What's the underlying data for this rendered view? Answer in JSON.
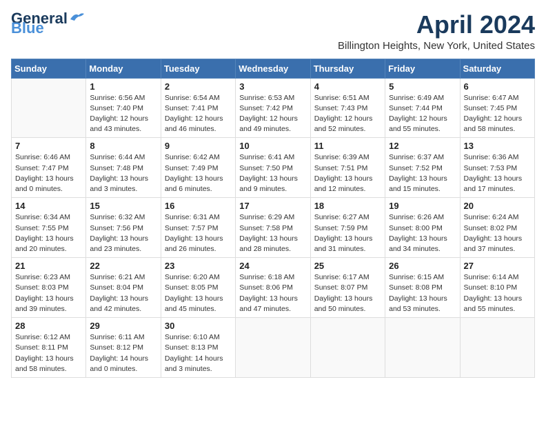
{
  "header": {
    "logo_general": "General",
    "logo_blue": "Blue",
    "month": "April 2024",
    "location": "Billington Heights, New York, United States"
  },
  "weekdays": [
    "Sunday",
    "Monday",
    "Tuesday",
    "Wednesday",
    "Thursday",
    "Friday",
    "Saturday"
  ],
  "weeks": [
    [
      {
        "day": "",
        "info": ""
      },
      {
        "day": "1",
        "info": "Sunrise: 6:56 AM\nSunset: 7:40 PM\nDaylight: 12 hours\nand 43 minutes."
      },
      {
        "day": "2",
        "info": "Sunrise: 6:54 AM\nSunset: 7:41 PM\nDaylight: 12 hours\nand 46 minutes."
      },
      {
        "day": "3",
        "info": "Sunrise: 6:53 AM\nSunset: 7:42 PM\nDaylight: 12 hours\nand 49 minutes."
      },
      {
        "day": "4",
        "info": "Sunrise: 6:51 AM\nSunset: 7:43 PM\nDaylight: 12 hours\nand 52 minutes."
      },
      {
        "day": "5",
        "info": "Sunrise: 6:49 AM\nSunset: 7:44 PM\nDaylight: 12 hours\nand 55 minutes."
      },
      {
        "day": "6",
        "info": "Sunrise: 6:47 AM\nSunset: 7:45 PM\nDaylight: 12 hours\nand 58 minutes."
      }
    ],
    [
      {
        "day": "7",
        "info": "Sunrise: 6:46 AM\nSunset: 7:47 PM\nDaylight: 13 hours\nand 0 minutes."
      },
      {
        "day": "8",
        "info": "Sunrise: 6:44 AM\nSunset: 7:48 PM\nDaylight: 13 hours\nand 3 minutes."
      },
      {
        "day": "9",
        "info": "Sunrise: 6:42 AM\nSunset: 7:49 PM\nDaylight: 13 hours\nand 6 minutes."
      },
      {
        "day": "10",
        "info": "Sunrise: 6:41 AM\nSunset: 7:50 PM\nDaylight: 13 hours\nand 9 minutes."
      },
      {
        "day": "11",
        "info": "Sunrise: 6:39 AM\nSunset: 7:51 PM\nDaylight: 13 hours\nand 12 minutes."
      },
      {
        "day": "12",
        "info": "Sunrise: 6:37 AM\nSunset: 7:52 PM\nDaylight: 13 hours\nand 15 minutes."
      },
      {
        "day": "13",
        "info": "Sunrise: 6:36 AM\nSunset: 7:53 PM\nDaylight: 13 hours\nand 17 minutes."
      }
    ],
    [
      {
        "day": "14",
        "info": "Sunrise: 6:34 AM\nSunset: 7:55 PM\nDaylight: 13 hours\nand 20 minutes."
      },
      {
        "day": "15",
        "info": "Sunrise: 6:32 AM\nSunset: 7:56 PM\nDaylight: 13 hours\nand 23 minutes."
      },
      {
        "day": "16",
        "info": "Sunrise: 6:31 AM\nSunset: 7:57 PM\nDaylight: 13 hours\nand 26 minutes."
      },
      {
        "day": "17",
        "info": "Sunrise: 6:29 AM\nSunset: 7:58 PM\nDaylight: 13 hours\nand 28 minutes."
      },
      {
        "day": "18",
        "info": "Sunrise: 6:27 AM\nSunset: 7:59 PM\nDaylight: 13 hours\nand 31 minutes."
      },
      {
        "day": "19",
        "info": "Sunrise: 6:26 AM\nSunset: 8:00 PM\nDaylight: 13 hours\nand 34 minutes."
      },
      {
        "day": "20",
        "info": "Sunrise: 6:24 AM\nSunset: 8:02 PM\nDaylight: 13 hours\nand 37 minutes."
      }
    ],
    [
      {
        "day": "21",
        "info": "Sunrise: 6:23 AM\nSunset: 8:03 PM\nDaylight: 13 hours\nand 39 minutes."
      },
      {
        "day": "22",
        "info": "Sunrise: 6:21 AM\nSunset: 8:04 PM\nDaylight: 13 hours\nand 42 minutes."
      },
      {
        "day": "23",
        "info": "Sunrise: 6:20 AM\nSunset: 8:05 PM\nDaylight: 13 hours\nand 45 minutes."
      },
      {
        "day": "24",
        "info": "Sunrise: 6:18 AM\nSunset: 8:06 PM\nDaylight: 13 hours\nand 47 minutes."
      },
      {
        "day": "25",
        "info": "Sunrise: 6:17 AM\nSunset: 8:07 PM\nDaylight: 13 hours\nand 50 minutes."
      },
      {
        "day": "26",
        "info": "Sunrise: 6:15 AM\nSunset: 8:08 PM\nDaylight: 13 hours\nand 53 minutes."
      },
      {
        "day": "27",
        "info": "Sunrise: 6:14 AM\nSunset: 8:10 PM\nDaylight: 13 hours\nand 55 minutes."
      }
    ],
    [
      {
        "day": "28",
        "info": "Sunrise: 6:12 AM\nSunset: 8:11 PM\nDaylight: 13 hours\nand 58 minutes."
      },
      {
        "day": "29",
        "info": "Sunrise: 6:11 AM\nSunset: 8:12 PM\nDaylight: 14 hours\nand 0 minutes."
      },
      {
        "day": "30",
        "info": "Sunrise: 6:10 AM\nSunset: 8:13 PM\nDaylight: 14 hours\nand 3 minutes."
      },
      {
        "day": "",
        "info": ""
      },
      {
        "day": "",
        "info": ""
      },
      {
        "day": "",
        "info": ""
      },
      {
        "day": "",
        "info": ""
      }
    ]
  ]
}
